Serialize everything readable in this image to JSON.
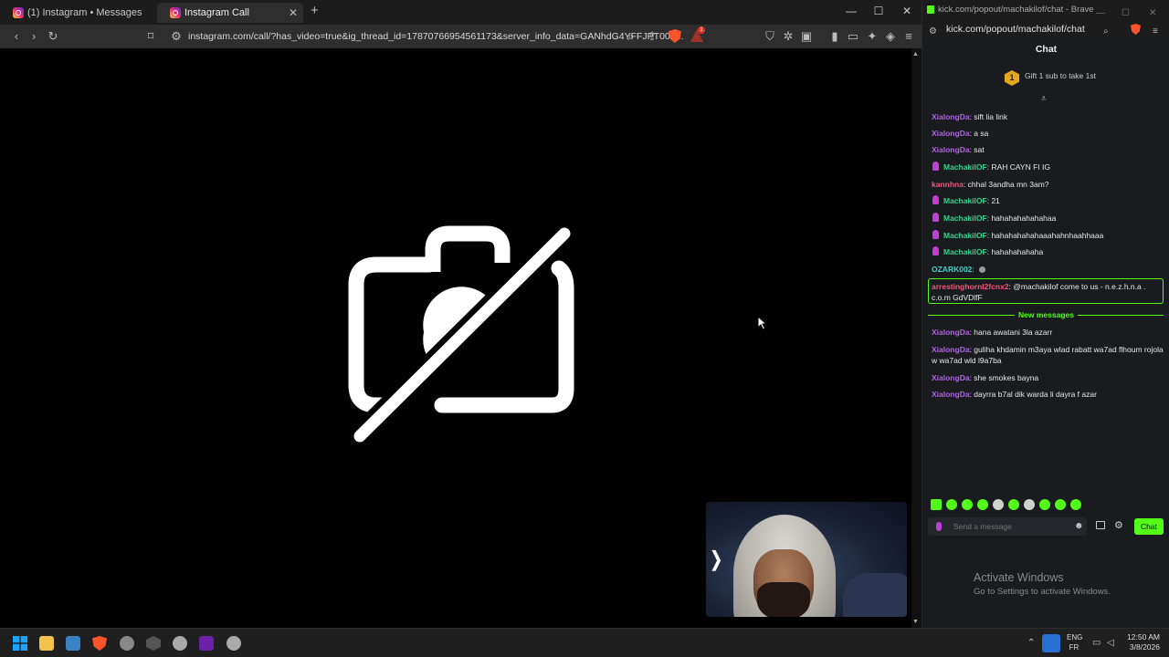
{
  "browser_left": {
    "tabs": [
      {
        "title": "(1) Instagram • Messages"
      },
      {
        "title": "Instagram Call"
      }
    ],
    "url": "instagram.com/call/?has_video=true&ig_thread_id=17870766954561173&server_info_data=GANhdG4YFFJPT006...",
    "brave_badge": "1"
  },
  "call": {
    "camera_state": "camera-off-icon"
  },
  "popout": {
    "window_title": "kick.com/popout/machakilof/chat - Brave",
    "address": "kick.com/popout/machakilof/chat",
    "header": "Chat",
    "gift_rank": "1",
    "gift_text": "Gift 1 sub to take 1st",
    "messages": [
      {
        "user": "XialongDa",
        "text": ": sift lia link"
      },
      {
        "user": "XialongDa",
        "text": ": a sa"
      },
      {
        "user": "XialongDa",
        "text": ": sat"
      },
      {
        "user": "MachakilOF",
        "text": ": RAH CAYN FI IG"
      },
      {
        "user": "kannhna",
        "text": ": chhal 3andha mn 3am?"
      },
      {
        "user": "MachakilOF",
        "text": ": 21"
      },
      {
        "user": "MachakilOF",
        "text": ": hahahahahahahaa"
      },
      {
        "user": "MachakilOF",
        "text": ": hahahahahahaaahahnhaahhaaa"
      },
      {
        "user": "MachakilOF",
        "text": ": hahahahahaha"
      },
      {
        "user": "OZARK002",
        "text": ":"
      },
      {
        "user": "arrestinghornl2fcnx2",
        "text": ": @machakilof come to us - n.e.z.h.n.a . c.o.m GdVDlfF"
      },
      {
        "user": "XialongDa",
        "text": ": hana awatani 3la azarr"
      },
      {
        "user": "XialongDa",
        "text": ": guliha khdamin m3aya wlad rabatt wa7ad flhoum rojola w wa7ad wld l9a7ba"
      },
      {
        "user": "XialongDa",
        "text": ": she smokes bayna"
      },
      {
        "user": "XialongDa",
        "text": ": dayrra b7al dik warda li dayra f azar"
      }
    ],
    "new_messages_label": "New messages",
    "input_placeholder": "Send a message",
    "chat_button": "Chat"
  },
  "watermark": {
    "title": "Activate Windows",
    "subtitle": "Go to Settings to activate Windows."
  },
  "taskbar": {
    "lang_top": "ENG",
    "lang_bottom": "FR",
    "time": "12:50 AM",
    "date": "3/8/2026"
  },
  "colors": {
    "kick_green": "#53fc18",
    "user_purple": "#b063e8",
    "user_green": "#2fd58a",
    "user_pink": "#f0567a",
    "user_teal": "#35d4c7"
  }
}
